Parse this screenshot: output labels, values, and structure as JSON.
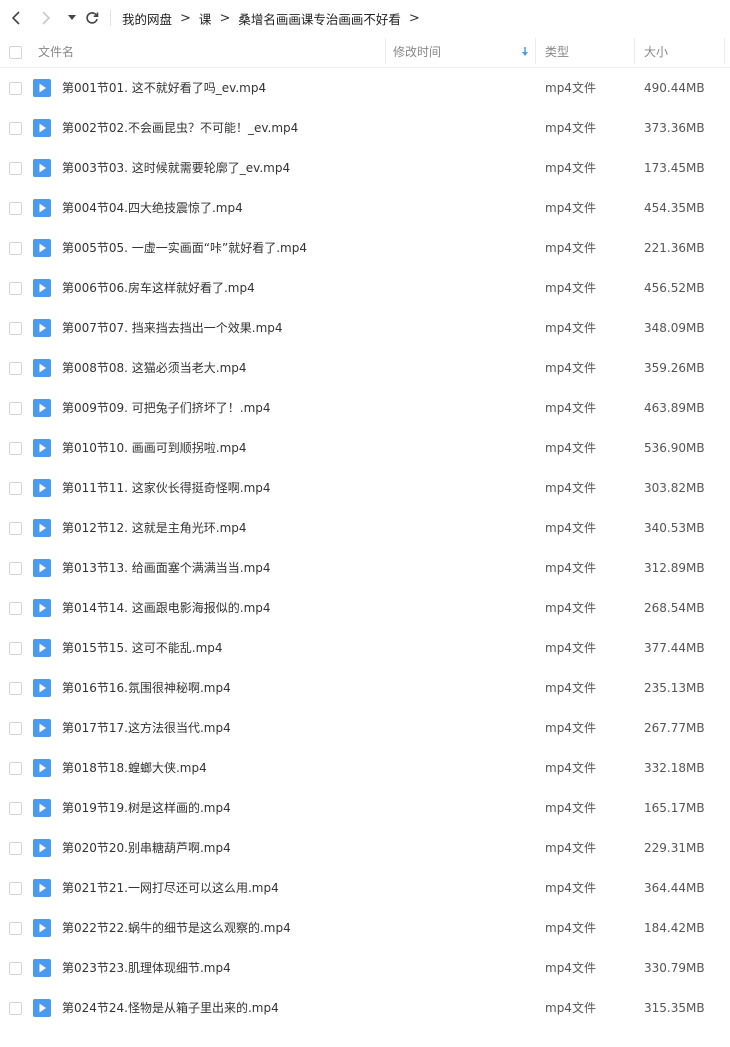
{
  "breadcrumb": [
    "我的网盘",
    "课",
    "桑增名画画课专治画画不好看"
  ],
  "columns": {
    "name": "文件名",
    "modified": "修改时间",
    "type": "类型",
    "size": "大小"
  },
  "files": [
    {
      "name": "第001节01. 这不就好看了吗_ev.mp4",
      "type": "mp4文件",
      "size": "490.44MB"
    },
    {
      "name": "第002节02.不会画昆虫？不可能！_ev.mp4",
      "type": "mp4文件",
      "size": "373.36MB"
    },
    {
      "name": "第003节03. 这时候就需要轮廓了_ev.mp4",
      "type": "mp4文件",
      "size": "173.45MB"
    },
    {
      "name": "第004节04.四大绝技震惊了.mp4",
      "type": "mp4文件",
      "size": "454.35MB"
    },
    {
      "name": "第005节05. 一虚一实画面“咔”就好看了.mp4",
      "type": "mp4文件",
      "size": "221.36MB"
    },
    {
      "name": "第006节06.房车这样就好看了.mp4",
      "type": "mp4文件",
      "size": "456.52MB"
    },
    {
      "name": "第007节07. 挡来挡去挡出一个效果.mp4",
      "type": "mp4文件",
      "size": "348.09MB"
    },
    {
      "name": "第008节08. 这猫必须当老大.mp4",
      "type": "mp4文件",
      "size": "359.26MB"
    },
    {
      "name": "第009节09. 可把兔子们挤坏了！.mp4",
      "type": "mp4文件",
      "size": "463.89MB"
    },
    {
      "name": "第010节10. 画画可到顺拐啦.mp4",
      "type": "mp4文件",
      "size": "536.90MB"
    },
    {
      "name": "第011节11. 这家伙长得挺奇怪啊.mp4",
      "type": "mp4文件",
      "size": "303.82MB"
    },
    {
      "name": "第012节12. 这就是主角光环.mp4",
      "type": "mp4文件",
      "size": "340.53MB"
    },
    {
      "name": "第013节13. 给画面塞个满满当当.mp4",
      "type": "mp4文件",
      "size": "312.89MB"
    },
    {
      "name": "第014节14. 这画跟电影海报似的.mp4",
      "type": "mp4文件",
      "size": "268.54MB"
    },
    {
      "name": "第015节15. 这可不能乱.mp4",
      "type": "mp4文件",
      "size": "377.44MB"
    },
    {
      "name": "第016节16.氛围很神秘啊.mp4",
      "type": "mp4文件",
      "size": "235.13MB"
    },
    {
      "name": "第017节17.这方法很当代.mp4",
      "type": "mp4文件",
      "size": "267.77MB"
    },
    {
      "name": "第018节18.蝗螂大侠.mp4",
      "type": "mp4文件",
      "size": "332.18MB"
    },
    {
      "name": "第019节19.树是这样画的.mp4",
      "type": "mp4文件",
      "size": "165.17MB"
    },
    {
      "name": "第020节20.别串糖葫芦啊.mp4",
      "type": "mp4文件",
      "size": "229.31MB"
    },
    {
      "name": "第021节21.一网打尽还可以这么用.mp4",
      "type": "mp4文件",
      "size": "364.44MB"
    },
    {
      "name": "第022节22.蜗牛的细节是这么观察的.mp4",
      "type": "mp4文件",
      "size": "184.42MB"
    },
    {
      "name": "第023节23.肌理体现细节.mp4",
      "type": "mp4文件",
      "size": "330.79MB"
    },
    {
      "name": "第024节24.怪物是从箱子里出来的.mp4",
      "type": "mp4文件",
      "size": "315.35MB"
    }
  ],
  "colors": {
    "accent": "#4a9bf0",
    "icon": "#4a9bf0",
    "header_text": "#888888"
  }
}
